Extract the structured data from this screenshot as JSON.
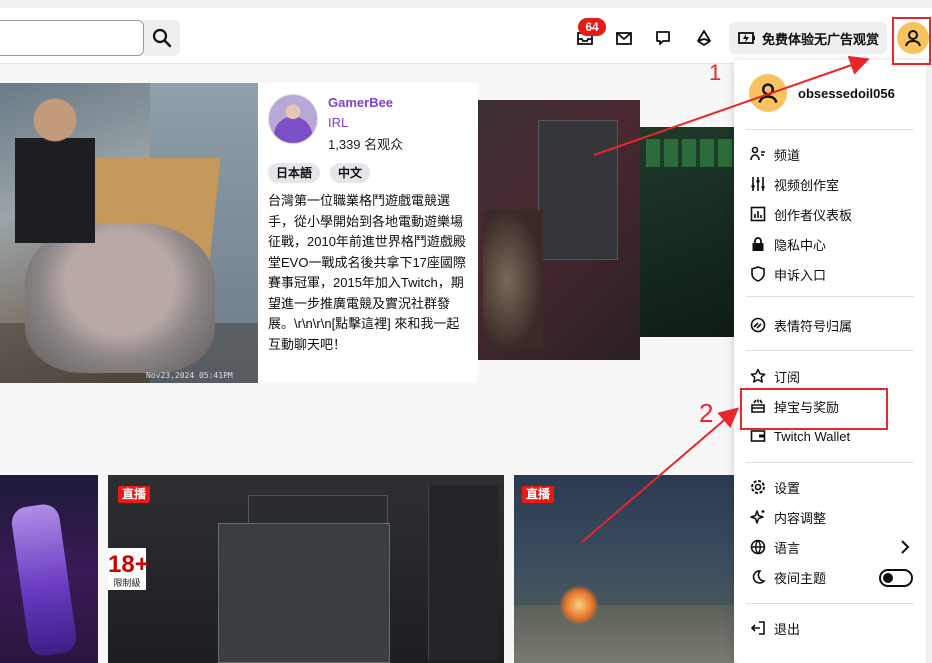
{
  "colors": {
    "accent_purple": "#8040d0",
    "live_red": "#e91916",
    "annotation_red": "#e8262b",
    "avatar_yellow": "#f7c35f"
  },
  "header": {
    "search_placeholder": "",
    "search_icon": "search-icon",
    "notification_count": "64",
    "promo_label": "免费体验无广告观赏"
  },
  "featured": {
    "streamer_name": "GamerBee",
    "category": "IRL",
    "viewers": "1,339 名观众",
    "tags": [
      "日本語",
      "中文"
    ],
    "description": "台灣第一位職業格鬥遊戲電競選手，從小學開始到各地電動遊樂場征戰，2010年前進世界格鬥遊戲殿堂EVO一戰成名後共拿下17座國際賽事冠軍，2015年加入Twitch，期望進一步推廣電競及實況社群發展。\\r\\n\\r\\n[點擊這裡] 來和我一起互動聊天吧！",
    "video_timestamp": "Nov23,2024 05:41PM"
  },
  "bottom_row": {
    "live_label": "直播",
    "age_rating": "18+",
    "age_rating_sub": "限制級"
  },
  "menu": {
    "username": "obsessedoil056",
    "items": [
      {
        "label": "频道",
        "icon": "channel-icon"
      },
      {
        "label": "视频创作室",
        "icon": "sliders-icon"
      },
      {
        "label": "创作者仪表板",
        "icon": "dashboard-icon"
      },
      {
        "label": "隐私中心",
        "icon": "lock-icon"
      },
      {
        "label": "申诉入口",
        "icon": "shield-icon"
      },
      {
        "label": "表情符号归属",
        "icon": "emote-icon"
      },
      {
        "label": "订阅",
        "icon": "star-icon"
      },
      {
        "label": "掉宝与奖励",
        "icon": "drops-icon"
      },
      {
        "label": "Twitch Wallet",
        "icon": "wallet-icon"
      },
      {
        "label": "设置",
        "icon": "gear-icon"
      },
      {
        "label": "内容调整",
        "icon": "sparkle-icon"
      },
      {
        "label": "语言",
        "icon": "globe-icon"
      },
      {
        "label": "夜间主题",
        "icon": "moon-icon"
      },
      {
        "label": "退出",
        "icon": "logout-icon"
      }
    ],
    "dark_mode_on": false
  },
  "annotations": {
    "step1": "1",
    "step2": "2"
  }
}
